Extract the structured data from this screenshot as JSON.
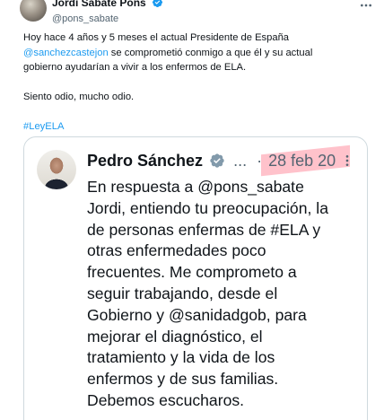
{
  "author": {
    "name": "Jordi Sabaté Pons",
    "handle": "@pons_sabate"
  },
  "tweet": {
    "line1": "Hoy hace 4 años y 5 meses el actual Presidente de España",
    "mention": "@sanchezcastejon",
    "line2_rest": " se comprometió conmigo a que él y su actual",
    "line3": "gobierno ayudarían a vivir a los enfermos de ELA.",
    "line4": "Siento odio, mucho odio.",
    "hashtag": "#LeyELA"
  },
  "quote": {
    "name": "Pedro Sánchez",
    "ellipsis": "...",
    "separator": "·",
    "date": "28 feb 20",
    "text_lines": [
      "En respuesta a @pons_sabate",
      "Jordi, entiendo tu preocupación, la",
      "de personas enfermas de #ELA y",
      "otras enfermedades poco",
      "frecuentes. Me comprometo a",
      "seguir trabajando, desde el",
      "Gobierno y @sanidadgob, para",
      "mejorar el diagnóstico, el",
      "tratamiento y la vida de los",
      "enfermos y de sus familias.",
      "Debemos escucharos."
    ]
  },
  "icons": {
    "verified_badge": "verified-icon",
    "more_options": "more-icon"
  },
  "colors": {
    "link": "#1d9bf0",
    "secondary_text": "#536471",
    "border": "#cfd9de",
    "date_highlight": "#ff788c"
  }
}
